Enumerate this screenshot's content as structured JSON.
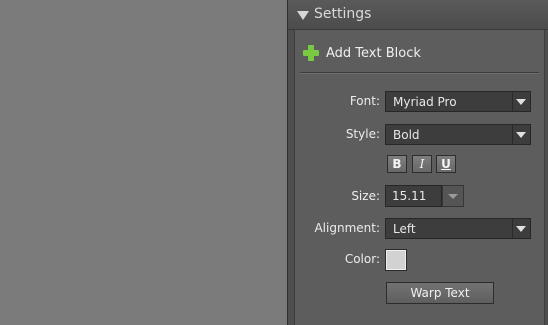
{
  "panel": {
    "title": "Settings",
    "add_text_block": "Add Text Block",
    "font": {
      "label": "Font:",
      "value": "Myriad Pro"
    },
    "style": {
      "label": "Style:",
      "value": "Bold",
      "buttons": {
        "bold": "B",
        "italic": "I",
        "underline": "U"
      }
    },
    "size": {
      "label": "Size:",
      "value": "15.11"
    },
    "alignment": {
      "label": "Alignment:",
      "value": "Left"
    },
    "color": {
      "label": "Color:",
      "swatch": "#d2d2d2"
    },
    "warp_button": "Warp Text"
  }
}
